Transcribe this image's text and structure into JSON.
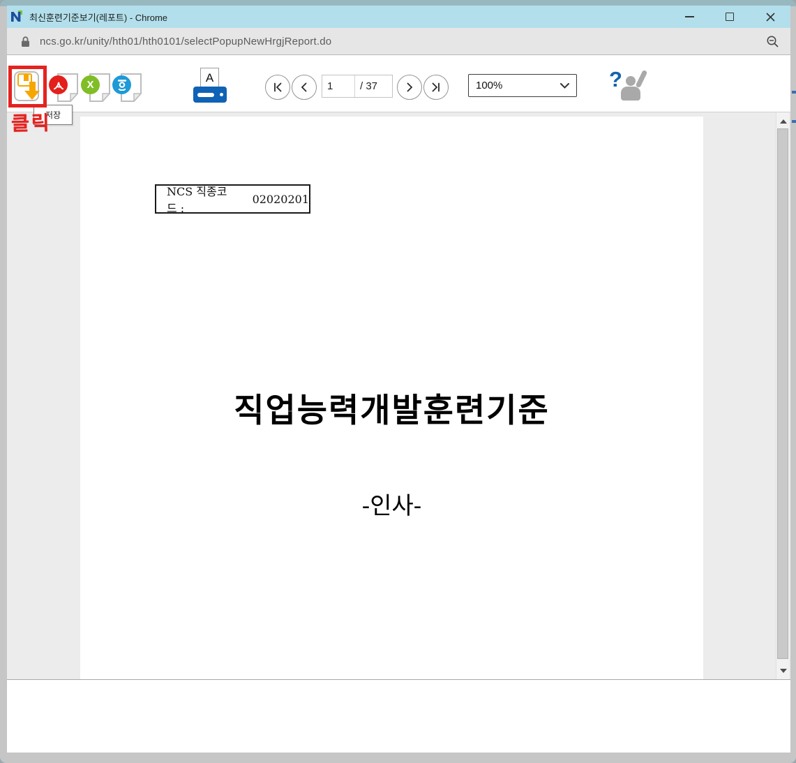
{
  "window": {
    "title": "최신훈련기준보기(레포트) - Chrome"
  },
  "address_bar": {
    "url": "ncs.go.kr/unity/hth01/hth0101/selectPopupNewHrgjReport.do"
  },
  "toolbar": {
    "save_tooltip": "저장",
    "click_annotation": "클릭",
    "page_current": "1",
    "page_total": "/ 37",
    "zoom_value": "100%",
    "excel_glyph": "X",
    "print_glyph": "A",
    "help_glyph": "?"
  },
  "document": {
    "code_label": "NCS 직종코드 :",
    "code_value": "02020201",
    "title": "직업능력개발훈련기준",
    "subtitle": "-인사-"
  },
  "icons": {
    "favicon": "ncs-logo",
    "save": "save-download-icon",
    "pdf": "pdf-export-icon",
    "excel": "excel-export-icon",
    "hwp": "hwp-export-icon",
    "print": "print-icon",
    "help": "help-person-icon"
  },
  "colors": {
    "titlebar": "#b2dfeb",
    "top_band": "#98b8c0",
    "frame": "#c6c6c6",
    "viewer_bg": "#ececec",
    "annotation_red": "#e42320",
    "save_orange": "#f7a600",
    "pdf_red": "#e3201b",
    "excel_green": "#7fbe26",
    "hwp_blue": "#1e9ad6",
    "print_blue": "#0f62b5",
    "help_blue": "#1464ab"
  }
}
